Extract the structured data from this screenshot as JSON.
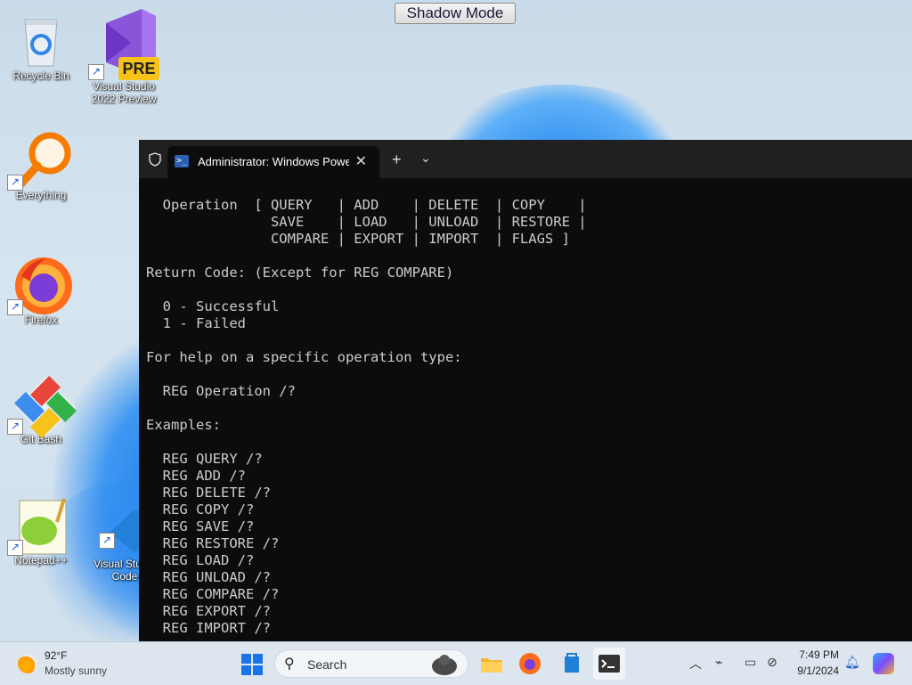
{
  "shadow_mode": {
    "label": "Shadow Mode"
  },
  "desktop": {
    "icons": [
      {
        "label": "Recycle Bin"
      },
      {
        "label": "Visual Studio 2022 Preview",
        "badge": "PRE"
      },
      {
        "label": "Everything"
      },
      {
        "label": "Firefox"
      },
      {
        "label": "Git Bash"
      },
      {
        "label": "Notepad++"
      },
      {
        "label": "Visual Studio Code"
      }
    ]
  },
  "terminal": {
    "tab_title": "Administrator: Windows PowerShell",
    "new_tab": "+",
    "dropdown": "⌄",
    "lines": [
      "  Operation  [ QUERY   | ADD    | DELETE  | COPY    |",
      "               SAVE    | LOAD   | UNLOAD  | RESTORE |",
      "               COMPARE | EXPORT | IMPORT  | FLAGS ]",
      "",
      "Return Code: (Except for REG COMPARE)",
      "",
      "  0 - Successful",
      "  1 - Failed",
      "",
      "For help on a specific operation type:",
      "",
      "  REG Operation /?",
      "",
      "Examples:",
      "",
      "  REG QUERY /?",
      "  REG ADD /?",
      "  REG DELETE /?",
      "  REG COPY /?",
      "  REG SAVE /?",
      "  REG RESTORE /?",
      "  REG LOAD /?",
      "  REG UNLOAD /?",
      "  REG COMPARE /?",
      "  REG EXPORT /?",
      "  REG IMPORT /?"
    ]
  },
  "taskbar": {
    "weather_temp": "92°F",
    "weather_desc": "Mostly sunny",
    "search_placeholder": "Search",
    "time": "7:49 PM",
    "date": "9/1/2024"
  }
}
